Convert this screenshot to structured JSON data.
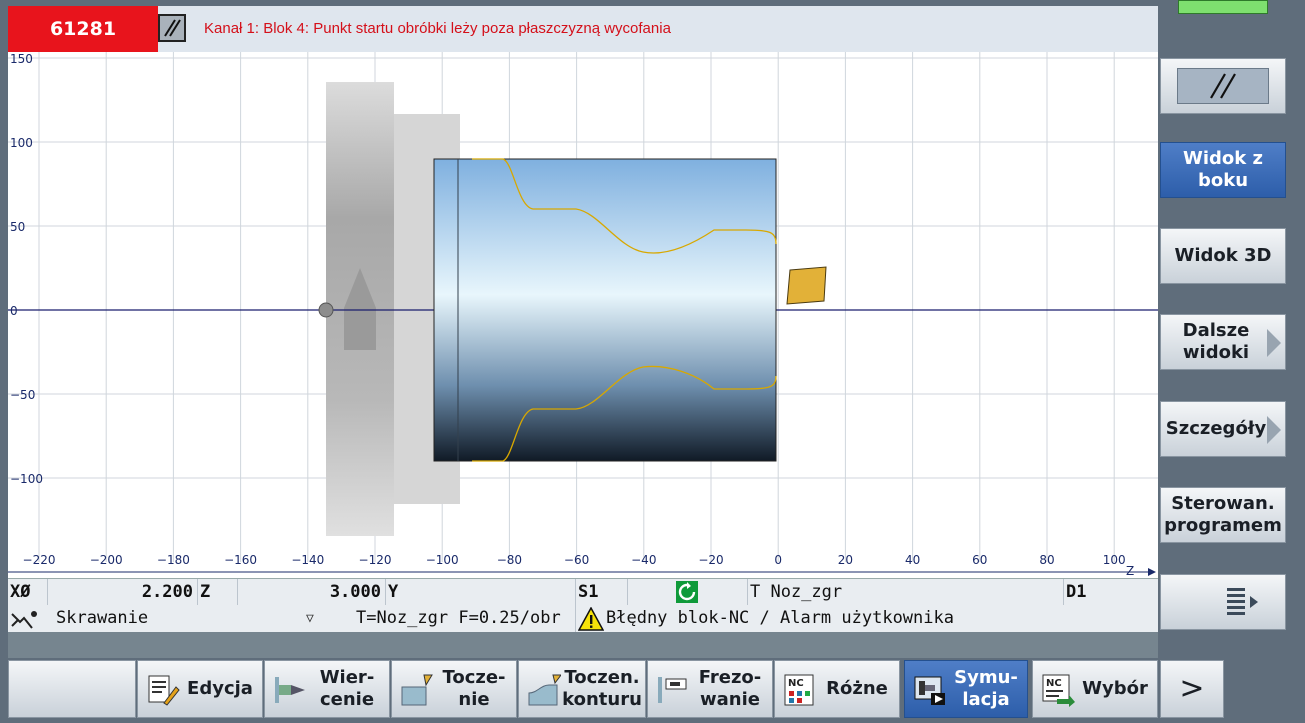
{
  "alarm": {
    "number": "61281",
    "ack_icon": "double-slash-icon",
    "message": "Kanał 1: Blok 4: Punkt startu obróbki leży poza płaszczyzną wycofania"
  },
  "axes": {
    "y_ticks": [
      "150",
      "100",
      "50",
      "0",
      "−50",
      "−100"
    ],
    "x_ticks": [
      "−220",
      "−200",
      "−180",
      "−160",
      "−140",
      "−120",
      "−100",
      "−80",
      "−60",
      "−40",
      "−20",
      "0",
      "20",
      "40",
      "60",
      "80",
      "100"
    ],
    "z_label": "Z"
  },
  "status": {
    "x_label": "XØ",
    "x_value": "2.200",
    "z_label": "Z",
    "z_value": "3.000",
    "y_label": "Y",
    "s_label": "S1",
    "tool": "T Noz_zgr",
    "d_label": "D1",
    "mode": "Skrawanie",
    "feed_info": "T=Noz_zgr F=0.25/obr",
    "alarm_text": "Błędny blok-NC / Alarm użytkownika",
    "spindle_color": "#0f9a3a"
  },
  "right_softkeys": [
    {
      "label": "Widok z boku",
      "active": true
    },
    {
      "label": "Widok 3D",
      "active": false
    },
    {
      "label": "Dalsze widoki",
      "active": false
    },
    {
      "label": "Szczegóły",
      "active": false
    },
    {
      "label": "Sterowan. programem",
      "active": false
    }
  ],
  "bottom_softkeys": [
    {
      "name": "edycja",
      "label": "Edycja",
      "icon": "edit-icon",
      "active": false
    },
    {
      "name": "wiercenie",
      "label": "Wier-cenie",
      "icon": "drill-icon",
      "active": false
    },
    {
      "name": "toczenie",
      "label": "Tocze-nie",
      "icon": "turning-icon",
      "active": false
    },
    {
      "name": "toczen-konturu",
      "label": "Toczen. konturu",
      "icon": "contour-turning-icon",
      "active": false
    },
    {
      "name": "frezowanie",
      "label": "Frezo-wanie",
      "icon": "milling-icon",
      "active": false
    },
    {
      "name": "rozne",
      "label": "Różne",
      "icon": "nc-misc-icon",
      "active": false
    },
    {
      "name": "symulacja",
      "label": "Symu-lacja",
      "icon": "simulation-icon",
      "active": true
    },
    {
      "name": "wybor",
      "label": "Wybór",
      "icon": "nc-select-icon",
      "active": false
    }
  ],
  "bottom_more": ">",
  "colors": {
    "alarm_red": "#e8141c",
    "active_blue": "#2d5eaa",
    "contour": "#d8a800"
  }
}
